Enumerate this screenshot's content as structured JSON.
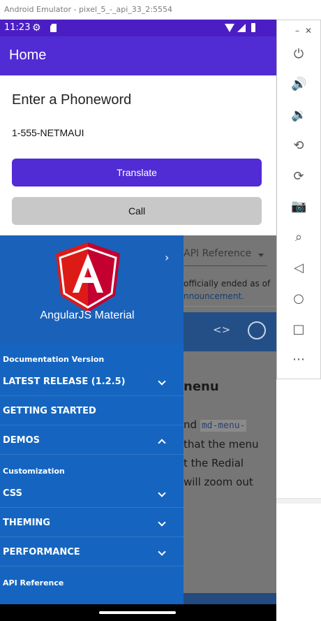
{
  "window": {
    "title": "Android Emulator - pixel_5_-_api_33_2:5554"
  },
  "status_bar": {
    "time": "11:23"
  },
  "app_bar": {
    "title": "Home"
  },
  "form": {
    "heading": "Enter a Phoneword",
    "phoneword_value": "1-555-NETMAUI",
    "translate_label": "Translate",
    "call_label": "Call"
  },
  "web_page": {
    "api_select": "API Reference",
    "notice_line1": "officially ended as of",
    "notice_line2": "nnouncement.",
    "section_heading": "nenu",
    "body_line1_prefix": "nd",
    "body_line1_code": "md-menu-",
    "body_line2": "that the menu",
    "body_line3": "t the Redial",
    "body_line4": "will zoom out"
  },
  "drawer": {
    "brand": "AngularJS Material",
    "sections": [
      {
        "title": "Documentation Version"
      },
      {
        "title": "Customization"
      },
      {
        "title": "API Reference"
      }
    ],
    "items": [
      {
        "label": "LATEST RELEASE (1.2.5)",
        "chevron": "down"
      },
      {
        "label": "GETTING STARTED"
      },
      {
        "label": "DEMOS",
        "chevron": "up"
      },
      {
        "label": "CSS",
        "chevron": "down"
      },
      {
        "label": "THEMING",
        "chevron": "down"
      },
      {
        "label": "PERFORMANCE",
        "chevron": "down"
      }
    ]
  },
  "emulator_panel": {
    "buttons": [
      "power-icon",
      "volume-up-icon",
      "volume-down-icon",
      "rotate-left-icon",
      "rotate-right-icon",
      "camera-icon",
      "zoom-icon",
      "back-icon",
      "home-icon",
      "overview-icon",
      "more-icon"
    ]
  },
  "colors": {
    "accent": "#512bd4",
    "status_bar": "#4a1ec4",
    "drawer": "#1565c0",
    "angular_red": "#dd1b16"
  }
}
